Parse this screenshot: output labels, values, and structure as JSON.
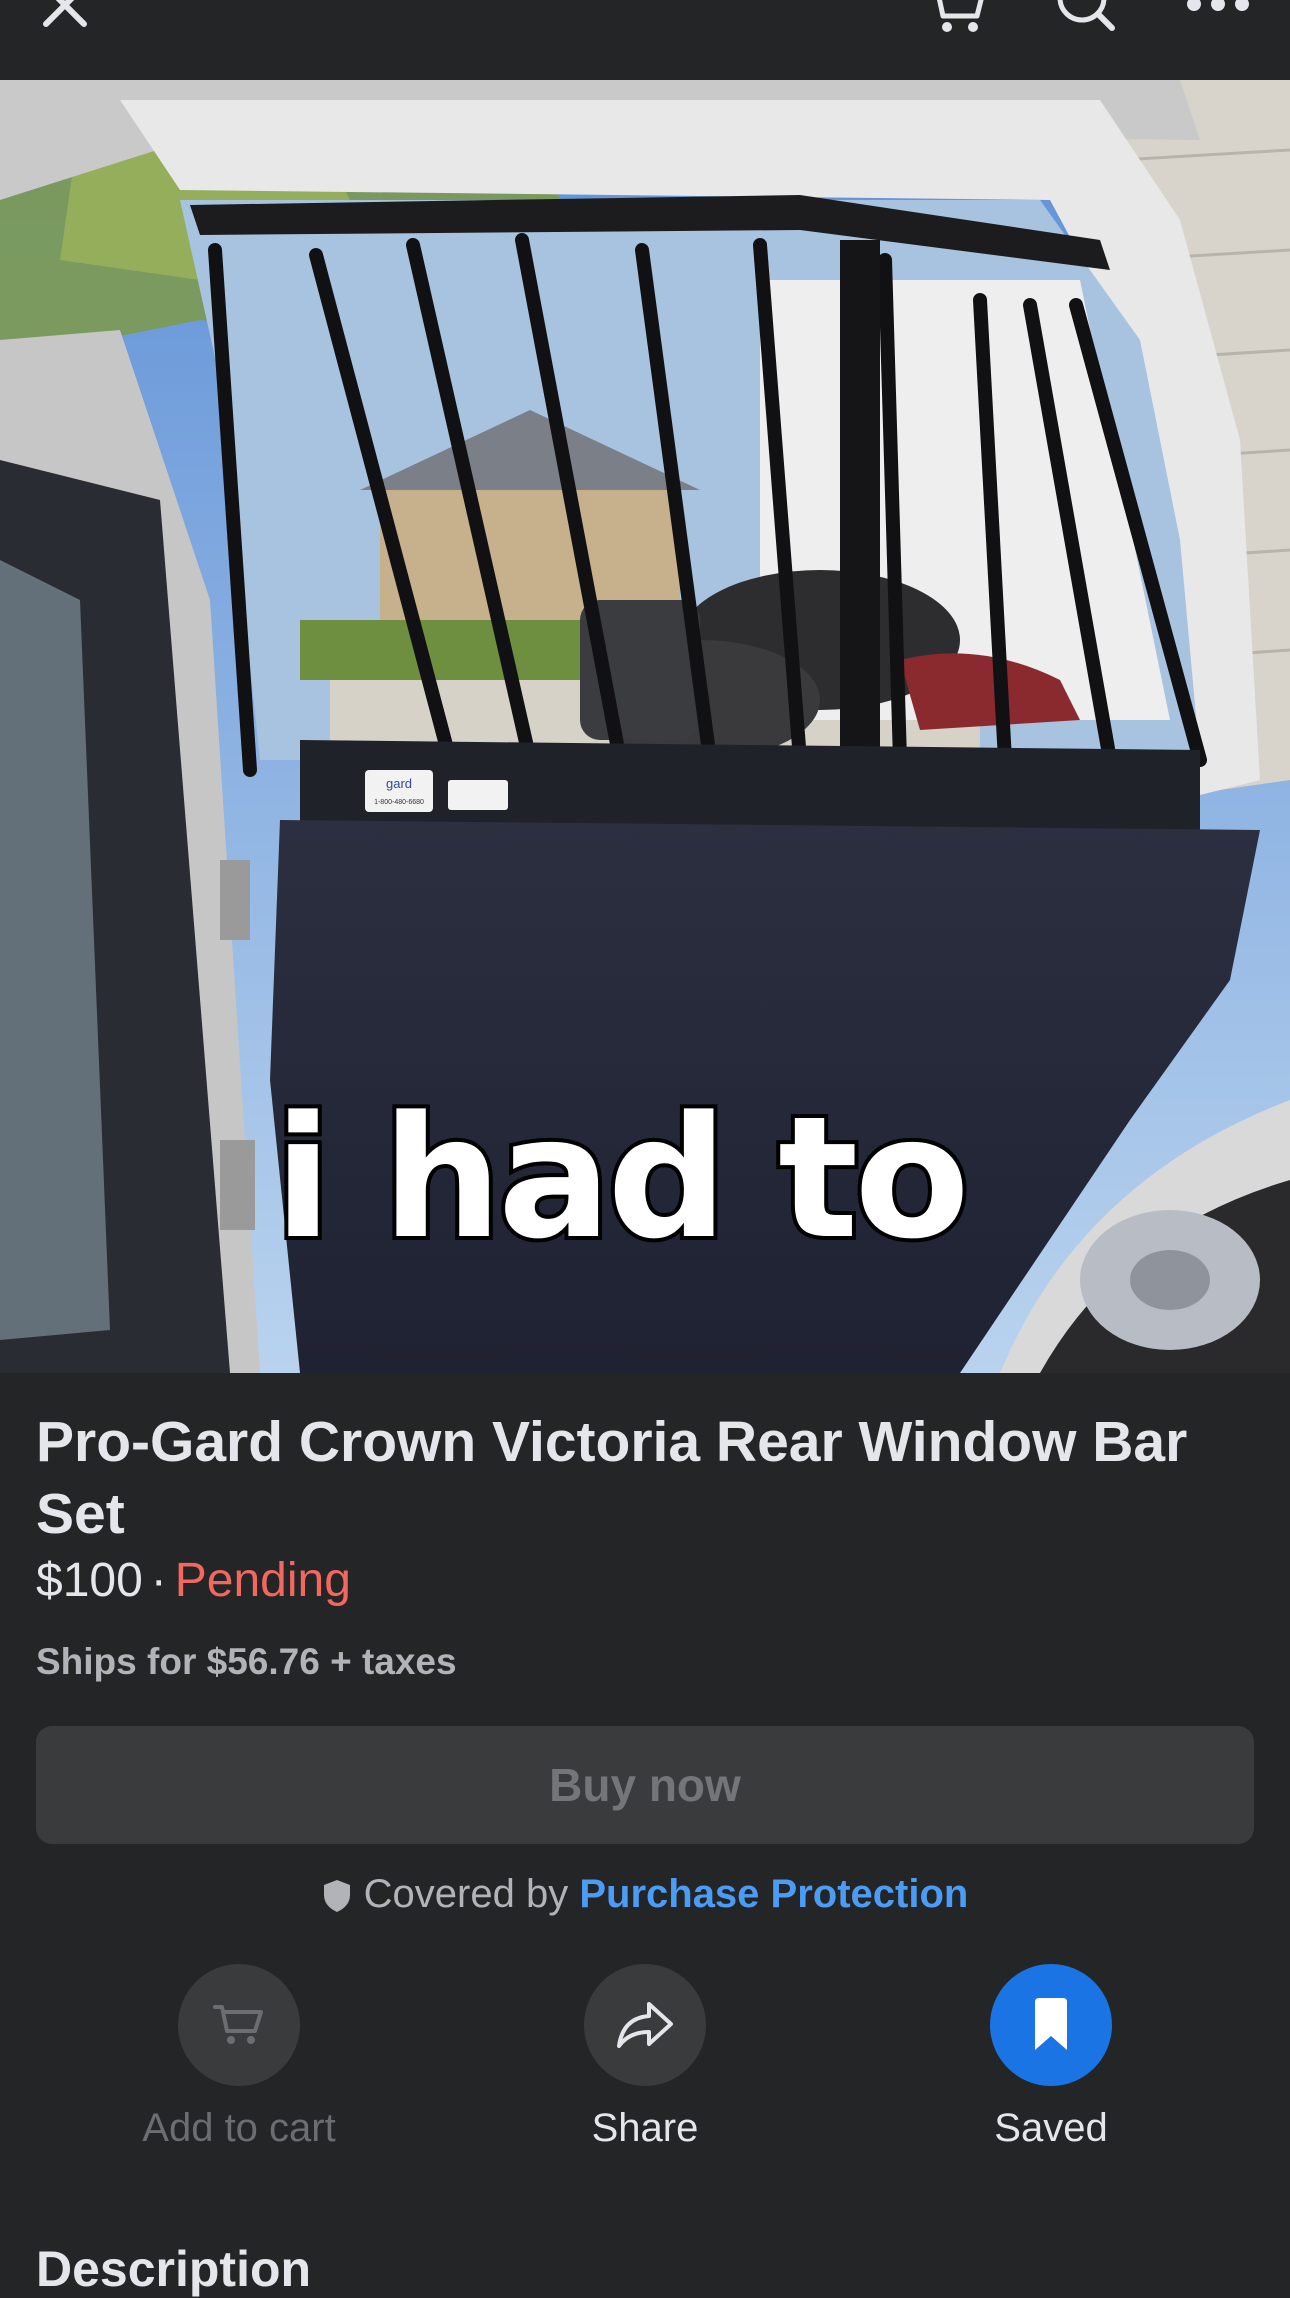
{
  "top_bar": {
    "close_icon": "close-icon",
    "cart_icon": "cart-icon",
    "search_icon": "search-icon",
    "more_icon": "more-horizontal-icon"
  },
  "photo": {
    "caption": "i had to",
    "sticker_brand": "gard",
    "sticker_phone": "1-800-480-6680"
  },
  "listing": {
    "title": "Pro-Gard Crown Victoria Rear Window Bar Set",
    "price": "$100",
    "separator": "·",
    "status": "Pending",
    "shipping": "Ships for $56.76 + taxes"
  },
  "buy_button": {
    "label": "Buy now"
  },
  "protection": {
    "prefix": "Covered by",
    "link": "Purchase Protection",
    "icon": "shield-icon"
  },
  "actions": [
    {
      "label": "Add to cart",
      "icon": "cart-icon",
      "enabled": false
    },
    {
      "label": "Share",
      "icon": "share-arrow-icon"
    },
    {
      "label": "Saved",
      "icon": "bookmark-icon",
      "active": true
    }
  ],
  "section": {
    "description_heading": "Description"
  },
  "colors": {
    "background": "#242526",
    "accent": "#1b74e4",
    "link": "#4b9cf5",
    "pending": "#f3685e",
    "button_disabled": "#3a3b3c"
  }
}
